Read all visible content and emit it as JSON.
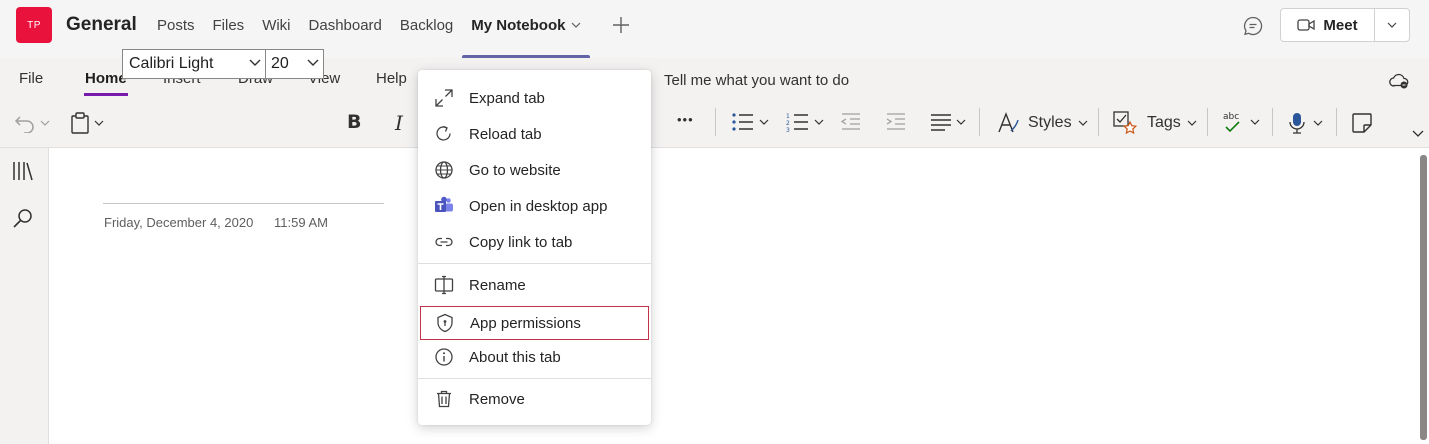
{
  "header": {
    "team_initials": "TP",
    "channel_name": "General",
    "tabs": [
      {
        "label": "Posts"
      },
      {
        "label": "Files"
      },
      {
        "label": "Wiki"
      },
      {
        "label": "Dashboard"
      },
      {
        "label": "Backlog"
      },
      {
        "label": "My Notebook",
        "active": true
      }
    ],
    "meet_label": "Meet"
  },
  "ribbon": {
    "tabs": [
      "File",
      "Home",
      "Insert",
      "Draw",
      "View",
      "Help"
    ],
    "active_tab": "Home",
    "tell_me_placeholder": "Tell me what you want to do",
    "font_name": "Calibri Light",
    "font_size": "20",
    "bold_glyph": "B",
    "italic_glyph": "I",
    "more_glyph": "•••",
    "styles_label": "Styles",
    "tags_label": "Tags"
  },
  "page": {
    "date": "Friday, December 4, 2020",
    "time": "11:59 AM"
  },
  "context_menu": {
    "items": [
      {
        "label": "Expand tab",
        "icon": "expand-icon"
      },
      {
        "label": "Reload tab",
        "icon": "reload-icon"
      },
      {
        "label": "Go to website",
        "icon": "globe-icon"
      },
      {
        "label": "Open in desktop app",
        "icon": "teams-icon"
      },
      {
        "label": "Copy link to tab",
        "icon": "link-icon"
      },
      {
        "label": "Rename",
        "icon": "rename-icon"
      },
      {
        "label": "App permissions",
        "icon": "shield-icon",
        "highlighted": true
      },
      {
        "label": "About this tab",
        "icon": "info-icon"
      },
      {
        "label": "Remove",
        "icon": "trash-icon"
      }
    ]
  },
  "colors": {
    "team_avatar": "#e8123c",
    "active_tab_underline": "#6264a7",
    "ribbon_active_underline": "#7719aa",
    "highlight_border": "#c4314b",
    "teams_brand": "#5b5fc7"
  }
}
